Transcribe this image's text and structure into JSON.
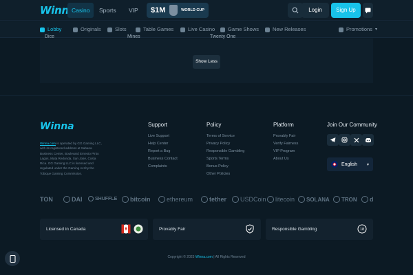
{
  "header": {
    "logo": "Winna",
    "tabs": [
      {
        "label": "Casino",
        "active": true
      },
      {
        "label": "Sports",
        "active": false
      },
      {
        "label": "VIP",
        "active": false
      }
    ],
    "promo": {
      "amount": "$1M",
      "tag": "WORLD CUP"
    },
    "login_label": "Login",
    "signup_label": "Sign Up",
    "accent_color": "#18c3ea"
  },
  "subnav": {
    "items": [
      {
        "label": "Lobby",
        "icon": "home-icon",
        "active": true
      },
      {
        "label": "Originals",
        "icon": "star-icon"
      },
      {
        "label": "Slots",
        "icon": "slots-icon"
      },
      {
        "label": "Table Games",
        "icon": "table-games-icon"
      },
      {
        "label": "Live Casino",
        "icon": "live-casino-icon"
      },
      {
        "label": "Game Shows",
        "icon": "game-shows-icon"
      },
      {
        "label": "New Releases",
        "icon": "new-releases-icon"
      }
    ],
    "promotions_label": "Promotions"
  },
  "content": {
    "cut_items": [
      "Dice",
      "Mines",
      "Twenty One"
    ],
    "show_less_label": "Show Less"
  },
  "footer": {
    "logo": "Winna",
    "description_link": "Winna.com",
    "description": " is operated by GG Gaming LLC, with its registered address at Sabana Business Center, Boulevard Ernesto Pinto Lagos, Mata Redonda, San José, Costa Rica. GG Gaming LLC is licensed and regulated under the Gaming Act by the Tobique Gaming Commission.",
    "columns": [
      {
        "title": "Support",
        "links": [
          "Live Support",
          "Help Center",
          "Report a Bug",
          "Business Contact",
          "Complaints"
        ]
      },
      {
        "title": "Policy",
        "links": [
          "Terms of Service",
          "Privacy Policy",
          "Responsible Gambling",
          "Sports Terms",
          "Bonus Policy",
          "Other Policies"
        ]
      },
      {
        "title": "Platform",
        "links": [
          "Provably Fair",
          "Verify Fairness",
          "VIP Program",
          "About Us"
        ]
      }
    ],
    "community_title": "Join Our Community",
    "social": [
      "telegram-icon",
      "instagram-icon",
      "x-icon",
      "discord-icon"
    ],
    "language": "English",
    "cryptos": [
      "TON",
      "DAI",
      "SHUFFLE",
      "bitcoin",
      "ethereum",
      "tether",
      "USDCoin",
      "litecoin",
      "SOLANA",
      "TRON",
      "d"
    ],
    "badges": [
      "Licensed in Canada",
      "Provably Fair",
      "Responsible Gambling"
    ],
    "copyright_prefix": "Copyright © 2025 ",
    "copyright_link": "Winna.com",
    "copyright_suffix": " | All Rights Reserved"
  }
}
